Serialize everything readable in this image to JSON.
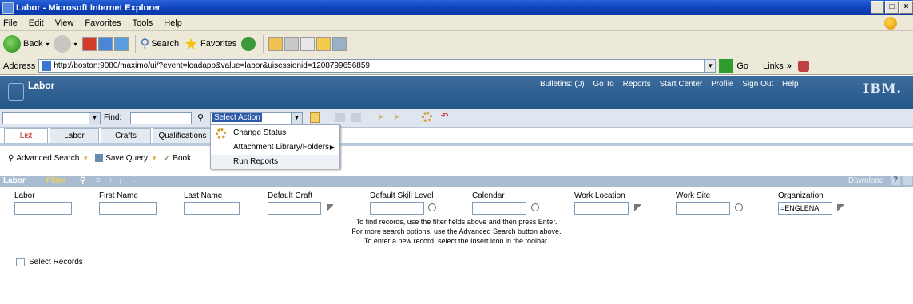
{
  "window": {
    "title": "Labor - Microsoft Internet Explorer",
    "controls": [
      "_",
      "×"
    ]
  },
  "menubar": {
    "items": [
      "File",
      "Edit",
      "View",
      "Favorites",
      "Tools",
      "Help"
    ]
  },
  "toolbar": {
    "back": "Back",
    "search": "Search",
    "favorites": "Favorites"
  },
  "address": {
    "label": "Address",
    "url": "http://boston:9080/maximo/ui/?event=loadapp&value=labor&uisessionid=1208799656859",
    "go": "Go",
    "links": "Links"
  },
  "app": {
    "title": "Labor",
    "bulletins": "Bulletins: (0)",
    "nav": [
      "Go To",
      "Reports",
      "Start Center",
      "Profile",
      "Sign Out",
      "Help"
    ],
    "brand": "IBM."
  },
  "findbar": {
    "find_label": "Find:",
    "select_action": "Select Action"
  },
  "tabs": [
    "List",
    "Labor",
    "Crafts",
    "Qualifications"
  ],
  "action_menu": {
    "items": [
      "Change Status",
      "Attachment Library/Folders",
      "Run Reports"
    ]
  },
  "actions": {
    "advanced_search": "Advanced Search",
    "save_query": "Save Query",
    "bookmarks": "Book"
  },
  "table": {
    "title": "Labor",
    "filter": "Filter",
    "download": "Download",
    "columns": [
      "Labor",
      "First Name",
      "Last Name",
      "Default Craft",
      "Default Skill Level",
      "Calendar",
      "Work Location",
      "Work Site",
      "Organization"
    ],
    "organization_filter": "=ENGLENA",
    "messages": [
      "To find records, use the filter fields above and then press Enter.",
      "For more search options, use the Advanced Search button above.",
      "To enter a new record, select the Insert icon in the toolbar."
    ]
  },
  "select_records": "Select Records"
}
